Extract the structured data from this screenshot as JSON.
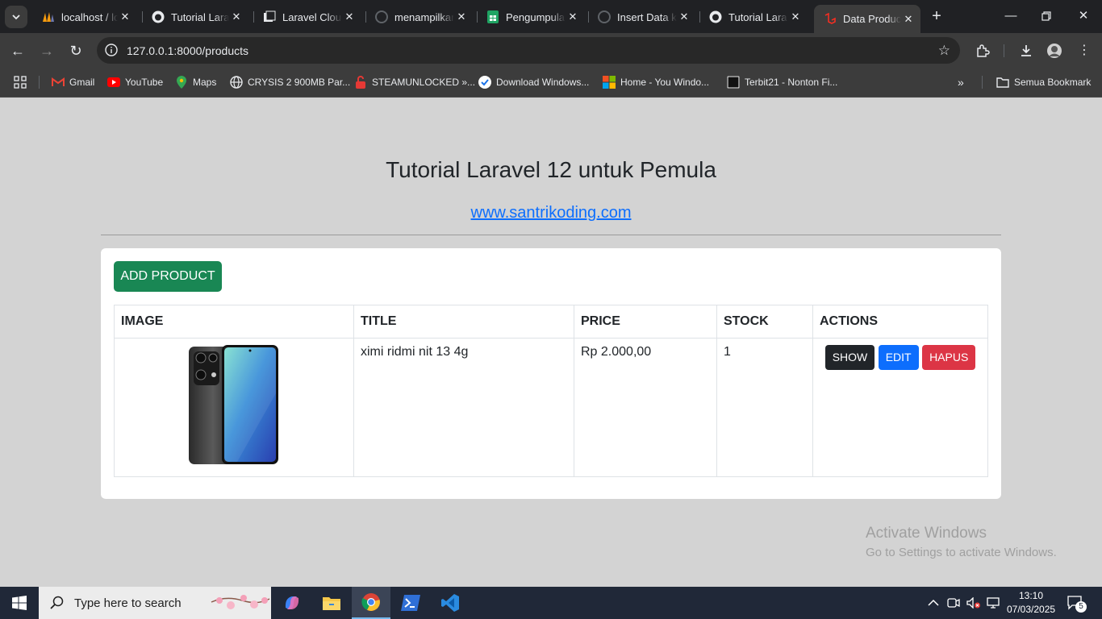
{
  "browser": {
    "tabs": [
      {
        "title": "localhost / lo",
        "icon": "phpmyadmin-icon"
      },
      {
        "title": "Tutorial Lara",
        "icon": "github-icon"
      },
      {
        "title": "Laravel Cloud",
        "icon": "laravel-cloud-icon"
      },
      {
        "title": "menampilkan",
        "icon": "github-icon"
      },
      {
        "title": "Pengumpula",
        "icon": "sheets-icon"
      },
      {
        "title": "Insert Data k",
        "icon": "github-icon"
      },
      {
        "title": "Tutorial Lara",
        "icon": "github-icon"
      },
      {
        "title": "Data Product",
        "icon": "laravel-icon",
        "active": true
      }
    ],
    "url": "127.0.0.1:8000/products",
    "bookmarks": [
      {
        "label": "Gmail",
        "icon": "gmail-icon"
      },
      {
        "label": "YouTube",
        "icon": "youtube-icon"
      },
      {
        "label": "Maps",
        "icon": "maps-icon"
      },
      {
        "label": "CRYSIS 2 900MB Par...",
        "icon": "globe-icon"
      },
      {
        "label": "STEAMUNLOCKED »...",
        "icon": "steamunlocked-icon"
      },
      {
        "label": "Download Windows...",
        "icon": "check-icon"
      },
      {
        "label": "Home - You Windo...",
        "icon": "windows-icon"
      },
      {
        "label": "Terbit21 - Nonton Fi...",
        "icon": "terbit21-icon"
      }
    ],
    "all_bookmarks": "Semua Bookmark"
  },
  "page": {
    "title": "Tutorial Laravel 12 untuk Pemula",
    "link": "www.santrikoding.com",
    "add_button": "ADD PRODUCT",
    "table": {
      "headers": [
        "IMAGE",
        "TITLE",
        "PRICE",
        "STOCK",
        "ACTIONS"
      ],
      "rows": [
        {
          "title": "ximi ridmi nit 13 4g",
          "price": "Rp 2.000,00",
          "stock": "1"
        }
      ]
    },
    "actions": {
      "show": "SHOW",
      "edit": "EDIT",
      "delete": "HAPUS"
    }
  },
  "watermark": {
    "line1": "Activate Windows",
    "line2": "Go to Settings to activate Windows."
  },
  "taskbar": {
    "search_placeholder": "Type here to search",
    "time": "13:10",
    "date": "07/03/2025",
    "notifications": "5"
  }
}
